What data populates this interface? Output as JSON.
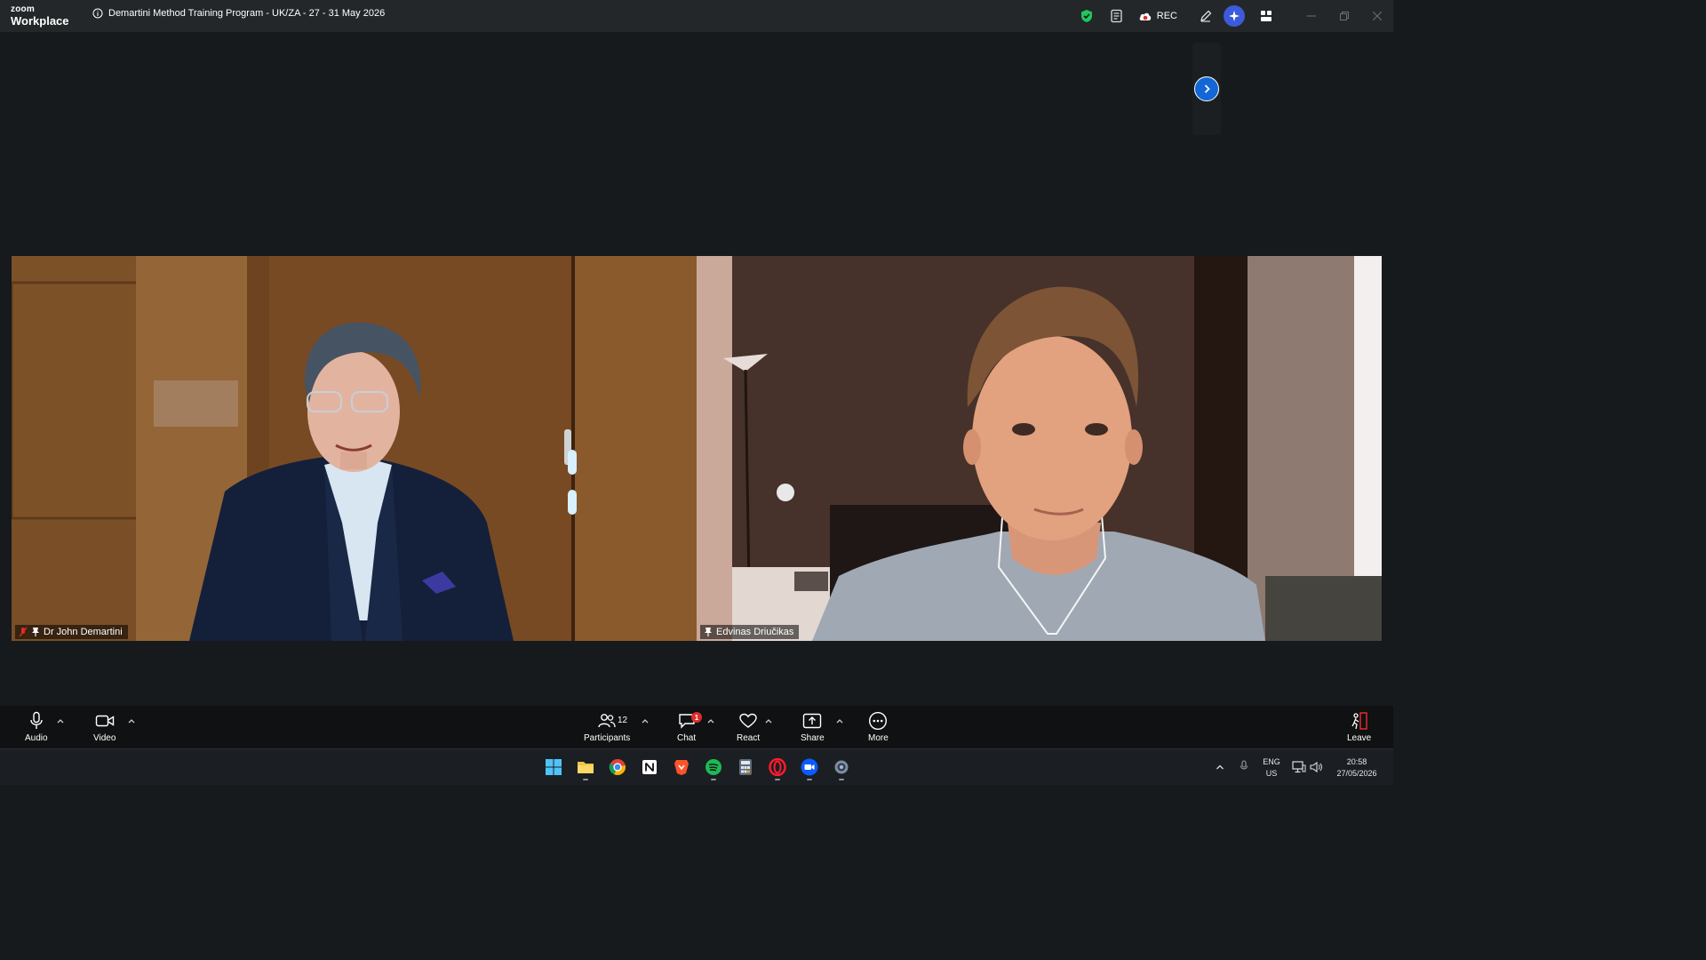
{
  "app": {
    "logo_top": "zoom",
    "logo_bottom": "Workplace"
  },
  "meeting": {
    "title": "Demartini Method Training Program - UK/ZA - 27 - 31 May 2026"
  },
  "titlebar": {
    "rec_label": "REC",
    "icons": [
      "shield-check-icon",
      "notes-icon",
      "cloud-rec-icon",
      "pen-icon",
      "ai-companion-icon",
      "apps-icon"
    ],
    "window_controls": [
      "minimize",
      "restore",
      "close"
    ]
  },
  "participants": [
    {
      "name": "Dr John Demartini",
      "muted": true,
      "pinned": true
    },
    {
      "name": "Edvinas Driučikas",
      "muted": false,
      "pinned": true
    }
  ],
  "toolbar": {
    "audio": "Audio",
    "video": "Video",
    "participants": "Participants",
    "participants_count": "12",
    "chat": "Chat",
    "chat_badge": "1",
    "react": "React",
    "share": "Share",
    "more": "More",
    "leave": "Leave"
  },
  "taskbar": {
    "apps": [
      "windows-start",
      "file-explorer",
      "chrome",
      "notion",
      "brave",
      "spotify",
      "calculator",
      "opera",
      "zoom",
      "settings"
    ],
    "lang_top": "ENG",
    "lang_bottom": "US",
    "time": "20:58",
    "date": "27/05/2026"
  },
  "colors": {
    "accent": "#1366d6",
    "leave_red": "#e02b2b",
    "shield_green": "#22c55e"
  }
}
